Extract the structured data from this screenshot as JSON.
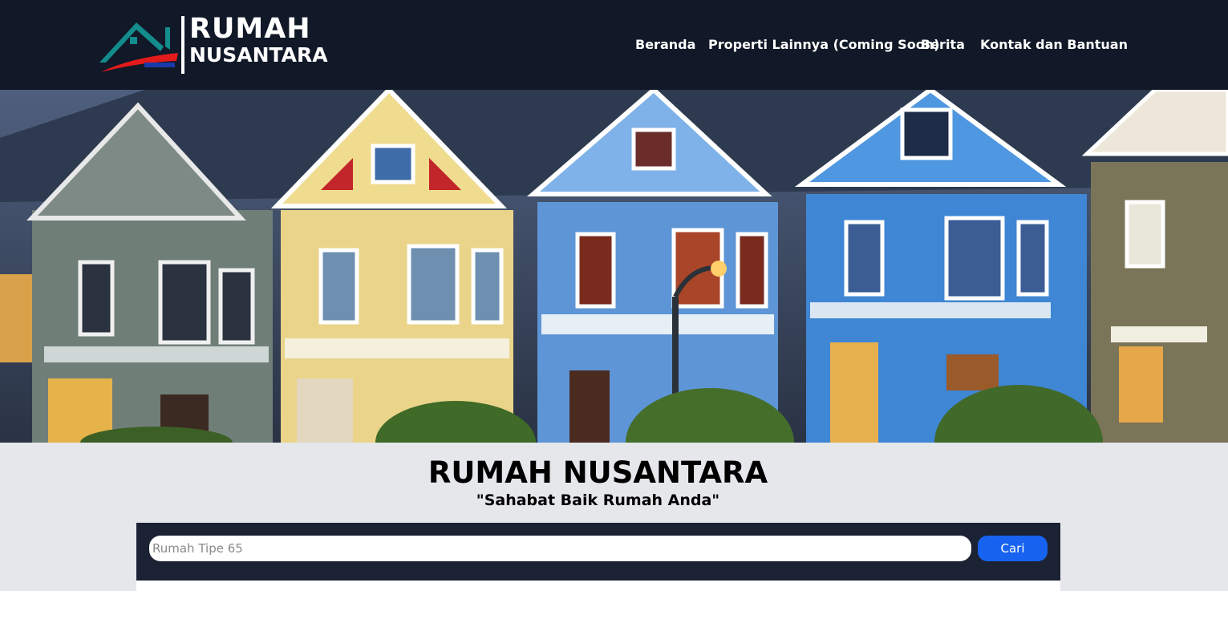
{
  "logo": {
    "word1": "RUMAH",
    "word2": "NUSANTARA",
    "colors": {
      "roof": "#138c8c",
      "swoosh": "#e41b1b"
    }
  },
  "nav": {
    "items": [
      {
        "label": "Beranda"
      },
      {
        "label": "Properti Lainnya (Coming Soon)"
      },
      {
        "label": "Berita"
      },
      {
        "label": "Kontak dan Bantuan"
      }
    ]
  },
  "hero": {
    "image": "victorian-houses-photo"
  },
  "main": {
    "title": "RUMAH NUSANTARA",
    "tagline": "\"Sahabat Baik Rumah Anda\""
  },
  "search": {
    "placeholder": "Rumah Tipe 65",
    "value": "",
    "button_label": "Cari"
  },
  "colors": {
    "navbar": "#111827",
    "content_bg": "#e5e7eb",
    "search_panel": "#1a2233",
    "accent": "#1763f0"
  }
}
